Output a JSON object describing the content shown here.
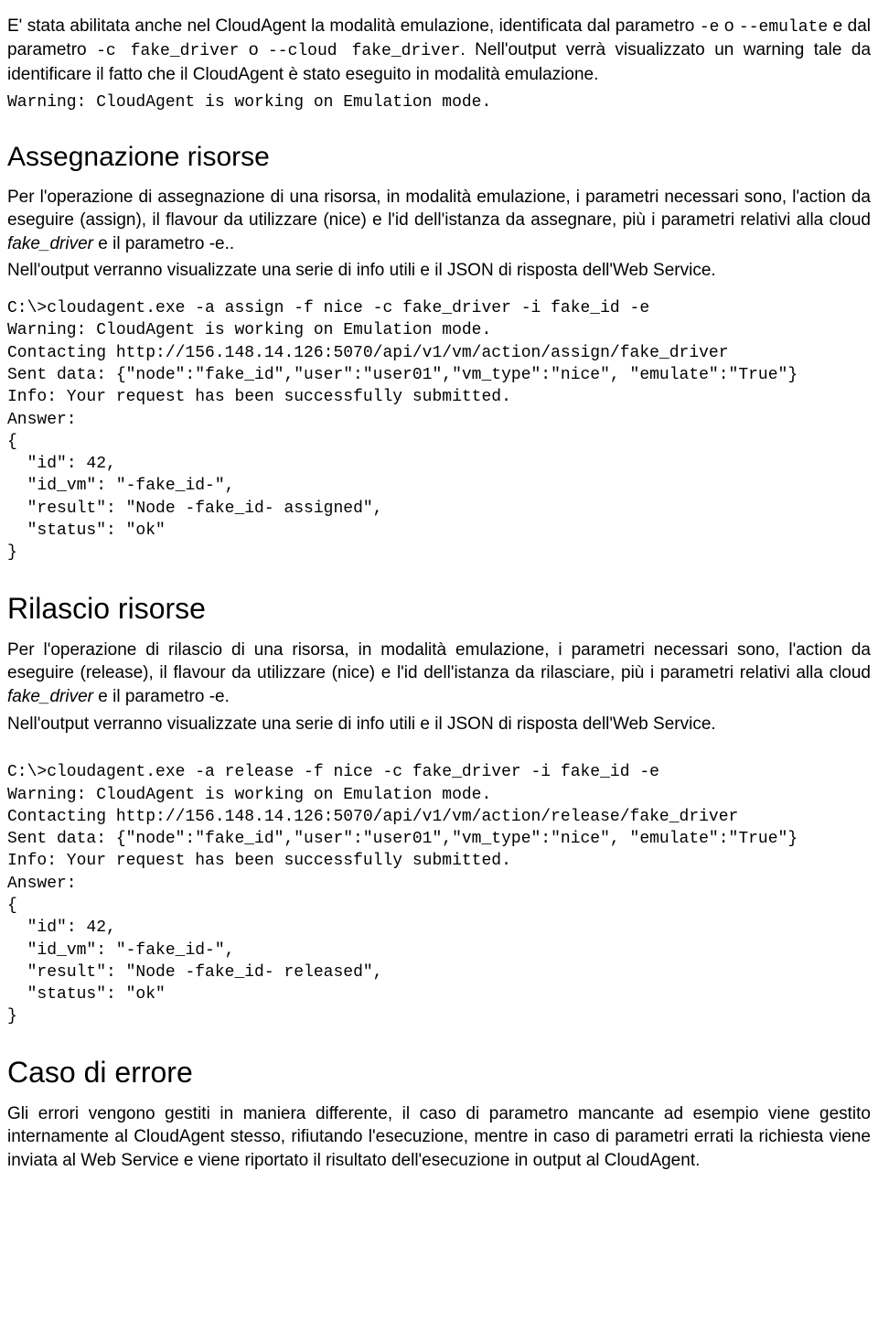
{
  "intro": {
    "p1_a": "E' stata abilitata anche nel CloudAgent la modalità emulazione, identificata dal parametro ",
    "p1_code1": "-e",
    "p1_b": " o ",
    "p1_code2": "--emulate",
    "p1_c": " e dal parametro ",
    "p1_code3": "-c fake_driver",
    "p1_d": " o ",
    "p1_code4": "--cloud fake_driver",
    "p1_e": ". Nell'output verrà visualizzato un warning tale da identificare il fatto che il CloudAgent è stato eseguito in modalità emulazione.",
    "code_warn": "Warning: CloudAgent is working on Emulation mode."
  },
  "assign": {
    "heading": "Assegnazione risorse",
    "p1_a": "Per l'operazione di assegnazione di una risorsa, in modalità emulazione, i parametri necessari sono, l'action da eseguire (assign), il flavour da utilizzare (nice) e l'id dell'istanza da assegnare, più i parametri relativi alla cloud ",
    "p1_i": "fake_driver",
    "p1_b": " e il parametro -e..",
    "p2": "Nell'output verranno visualizzate una serie di info utili e il JSON di risposta dell'Web Service.",
    "code": "C:\\>cloudagent.exe -a assign -f nice -c fake_driver -i fake_id -e\nWarning: CloudAgent is working on Emulation mode.\nContacting http://156.148.14.126:5070/api/v1/vm/action/assign/fake_driver\nSent data: {\"node\":\"fake_id\",\"user\":\"user01\",\"vm_type\":\"nice\", \"emulate\":\"True\"}\nInfo: Your request has been successfully submitted.\nAnswer:\n{\n  \"id\": 42,\n  \"id_vm\": \"-fake_id-\",\n  \"result\": \"Node -fake_id- assigned\",\n  \"status\": \"ok\"\n}"
  },
  "release": {
    "heading": "Rilascio risorse",
    "p1_a": "Per l'operazione di rilascio di una risorsa, in modalità emulazione, i parametri necessari sono, l'action da eseguire (release), il flavour da utilizzare (nice) e l'id dell'istanza da rilasciare, più i parametri relativi alla cloud ",
    "p1_i": "fake_driver",
    "p1_b": " e il parametro -e.",
    "p2": "Nell'output verranno visualizzate una serie di info utili e il JSON di risposta dell'Web Service.",
    "code": "C:\\>cloudagent.exe -a release -f nice -c fake_driver -i fake_id -e\nWarning: CloudAgent is working on Emulation mode.\nContacting http://156.148.14.126:5070/api/v1/vm/action/release/fake_driver\nSent data: {\"node\":\"fake_id\",\"user\":\"user01\",\"vm_type\":\"nice\", \"emulate\":\"True\"}\nInfo: Your request has been successfully submitted.\nAnswer:\n{\n  \"id\": 42,\n  \"id_vm\": \"-fake_id-\",\n  \"result\": \"Node -fake_id- released\",\n  \"status\": \"ok\"\n}"
  },
  "error": {
    "heading": "Caso di errore",
    "p1": "Gli errori vengono gestiti in maniera differente, il caso di parametro mancante ad esempio viene gestito internamente al CloudAgent stesso, rifiutando l'esecuzione, mentre in caso di parametri errati la richiesta viene inviata al Web Service e viene riportato il risultato dell'esecuzione in output al CloudAgent."
  }
}
